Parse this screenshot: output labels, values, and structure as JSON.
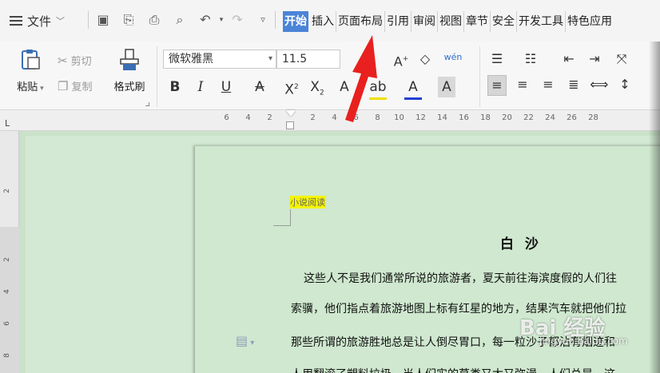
{
  "menu": {
    "file_label": "文件",
    "tabs": [
      "开始",
      "插入",
      "页面布局",
      "引用",
      "审阅",
      "视图",
      "章节",
      "安全",
      "开发工具",
      "特色应用"
    ],
    "active_tab": "开始"
  },
  "ribbon": {
    "paste_label": "粘贴",
    "cut_label": "剪切",
    "copy_label": "复制",
    "format_painter_label": "格式刷",
    "font_name": "微软雅黑",
    "font_size": "11.5",
    "phonetic_label": "wén"
  },
  "ruler": {
    "numbers": [
      "6",
      "4",
      "2",
      "",
      "2",
      "4",
      "6",
      "8",
      "10",
      "12",
      "14",
      "16",
      "18",
      "20",
      "22",
      "24",
      "26",
      "28"
    ],
    "vertical_numbers": [
      "2",
      "2",
      "4",
      "6",
      "8"
    ]
  },
  "document": {
    "header_text": "小说阅读",
    "title": "白 沙",
    "lines": [
      "这些人不是我们通常所说的旅游者，夏天前往海滨度假的人们往",
      "索骥，他们指点着旅游地图上标有红星的地方，结果汽车就把他们拉",
      "那些所谓的旅游胜地总是让人倒尽胃口，每一粒沙子都沾有烟迹和",
      "人用翻滚了塑料垃圾，当人们实的草类又太又弥漫，人们总是，这"
    ]
  },
  "watermark": {
    "brand": "Bai 经验",
    "url": "jingyan.baidu.com"
  },
  "colors": {
    "active_tab": "#4b84d6",
    "highlight": "#f4f400",
    "page_bg": "#cfe8cf",
    "arrow": "#e8201f"
  }
}
